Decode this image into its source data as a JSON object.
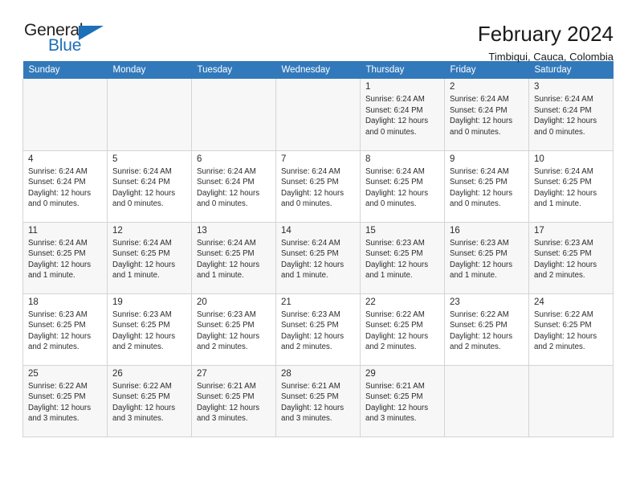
{
  "brand": {
    "name_part1": "General",
    "name_part2": "Blue",
    "triangle_icon": "triangle-icon",
    "color_primary": "#1d6fb8",
    "color_text": "#231f20"
  },
  "header": {
    "title": "February 2024",
    "subtitle": "Timbiqui, Cauca, Colombia"
  },
  "calendar": {
    "header_bg": "#3279bb",
    "columns": [
      "Sunday",
      "Monday",
      "Tuesday",
      "Wednesday",
      "Thursday",
      "Friday",
      "Saturday"
    ],
    "weeks": [
      [
        {
          "day": ""
        },
        {
          "day": ""
        },
        {
          "day": ""
        },
        {
          "day": ""
        },
        {
          "day": "1",
          "sunrise": "Sunrise: 6:24 AM",
          "sunset": "Sunset: 6:24 PM",
          "daylight_line1": "Daylight: 12 hours",
          "daylight_line2": "and 0 minutes."
        },
        {
          "day": "2",
          "sunrise": "Sunrise: 6:24 AM",
          "sunset": "Sunset: 6:24 PM",
          "daylight_line1": "Daylight: 12 hours",
          "daylight_line2": "and 0 minutes."
        },
        {
          "day": "3",
          "sunrise": "Sunrise: 6:24 AM",
          "sunset": "Sunset: 6:24 PM",
          "daylight_line1": "Daylight: 12 hours",
          "daylight_line2": "and 0 minutes."
        }
      ],
      [
        {
          "day": "4",
          "sunrise": "Sunrise: 6:24 AM",
          "sunset": "Sunset: 6:24 PM",
          "daylight_line1": "Daylight: 12 hours",
          "daylight_line2": "and 0 minutes."
        },
        {
          "day": "5",
          "sunrise": "Sunrise: 6:24 AM",
          "sunset": "Sunset: 6:24 PM",
          "daylight_line1": "Daylight: 12 hours",
          "daylight_line2": "and 0 minutes."
        },
        {
          "day": "6",
          "sunrise": "Sunrise: 6:24 AM",
          "sunset": "Sunset: 6:24 PM",
          "daylight_line1": "Daylight: 12 hours",
          "daylight_line2": "and 0 minutes."
        },
        {
          "day": "7",
          "sunrise": "Sunrise: 6:24 AM",
          "sunset": "Sunset: 6:25 PM",
          "daylight_line1": "Daylight: 12 hours",
          "daylight_line2": "and 0 minutes."
        },
        {
          "day": "8",
          "sunrise": "Sunrise: 6:24 AM",
          "sunset": "Sunset: 6:25 PM",
          "daylight_line1": "Daylight: 12 hours",
          "daylight_line2": "and 0 minutes."
        },
        {
          "day": "9",
          "sunrise": "Sunrise: 6:24 AM",
          "sunset": "Sunset: 6:25 PM",
          "daylight_line1": "Daylight: 12 hours",
          "daylight_line2": "and 0 minutes."
        },
        {
          "day": "10",
          "sunrise": "Sunrise: 6:24 AM",
          "sunset": "Sunset: 6:25 PM",
          "daylight_line1": "Daylight: 12 hours",
          "daylight_line2": "and 1 minute."
        }
      ],
      [
        {
          "day": "11",
          "sunrise": "Sunrise: 6:24 AM",
          "sunset": "Sunset: 6:25 PM",
          "daylight_line1": "Daylight: 12 hours",
          "daylight_line2": "and 1 minute."
        },
        {
          "day": "12",
          "sunrise": "Sunrise: 6:24 AM",
          "sunset": "Sunset: 6:25 PM",
          "daylight_line1": "Daylight: 12 hours",
          "daylight_line2": "and 1 minute."
        },
        {
          "day": "13",
          "sunrise": "Sunrise: 6:24 AM",
          "sunset": "Sunset: 6:25 PM",
          "daylight_line1": "Daylight: 12 hours",
          "daylight_line2": "and 1 minute."
        },
        {
          "day": "14",
          "sunrise": "Sunrise: 6:24 AM",
          "sunset": "Sunset: 6:25 PM",
          "daylight_line1": "Daylight: 12 hours",
          "daylight_line2": "and 1 minute."
        },
        {
          "day": "15",
          "sunrise": "Sunrise: 6:23 AM",
          "sunset": "Sunset: 6:25 PM",
          "daylight_line1": "Daylight: 12 hours",
          "daylight_line2": "and 1 minute."
        },
        {
          "day": "16",
          "sunrise": "Sunrise: 6:23 AM",
          "sunset": "Sunset: 6:25 PM",
          "daylight_line1": "Daylight: 12 hours",
          "daylight_line2": "and 1 minute."
        },
        {
          "day": "17",
          "sunrise": "Sunrise: 6:23 AM",
          "sunset": "Sunset: 6:25 PM",
          "daylight_line1": "Daylight: 12 hours",
          "daylight_line2": "and 2 minutes."
        }
      ],
      [
        {
          "day": "18",
          "sunrise": "Sunrise: 6:23 AM",
          "sunset": "Sunset: 6:25 PM",
          "daylight_line1": "Daylight: 12 hours",
          "daylight_line2": "and 2 minutes."
        },
        {
          "day": "19",
          "sunrise": "Sunrise: 6:23 AM",
          "sunset": "Sunset: 6:25 PM",
          "daylight_line1": "Daylight: 12 hours",
          "daylight_line2": "and 2 minutes."
        },
        {
          "day": "20",
          "sunrise": "Sunrise: 6:23 AM",
          "sunset": "Sunset: 6:25 PM",
          "daylight_line1": "Daylight: 12 hours",
          "daylight_line2": "and 2 minutes."
        },
        {
          "day": "21",
          "sunrise": "Sunrise: 6:23 AM",
          "sunset": "Sunset: 6:25 PM",
          "daylight_line1": "Daylight: 12 hours",
          "daylight_line2": "and 2 minutes."
        },
        {
          "day": "22",
          "sunrise": "Sunrise: 6:22 AM",
          "sunset": "Sunset: 6:25 PM",
          "daylight_line1": "Daylight: 12 hours",
          "daylight_line2": "and 2 minutes."
        },
        {
          "day": "23",
          "sunrise": "Sunrise: 6:22 AM",
          "sunset": "Sunset: 6:25 PM",
          "daylight_line1": "Daylight: 12 hours",
          "daylight_line2": "and 2 minutes."
        },
        {
          "day": "24",
          "sunrise": "Sunrise: 6:22 AM",
          "sunset": "Sunset: 6:25 PM",
          "daylight_line1": "Daylight: 12 hours",
          "daylight_line2": "and 2 minutes."
        }
      ],
      [
        {
          "day": "25",
          "sunrise": "Sunrise: 6:22 AM",
          "sunset": "Sunset: 6:25 PM",
          "daylight_line1": "Daylight: 12 hours",
          "daylight_line2": "and 3 minutes."
        },
        {
          "day": "26",
          "sunrise": "Sunrise: 6:22 AM",
          "sunset": "Sunset: 6:25 PM",
          "daylight_line1": "Daylight: 12 hours",
          "daylight_line2": "and 3 minutes."
        },
        {
          "day": "27",
          "sunrise": "Sunrise: 6:21 AM",
          "sunset": "Sunset: 6:25 PM",
          "daylight_line1": "Daylight: 12 hours",
          "daylight_line2": "and 3 minutes."
        },
        {
          "day": "28",
          "sunrise": "Sunrise: 6:21 AM",
          "sunset": "Sunset: 6:25 PM",
          "daylight_line1": "Daylight: 12 hours",
          "daylight_line2": "and 3 minutes."
        },
        {
          "day": "29",
          "sunrise": "Sunrise: 6:21 AM",
          "sunset": "Sunset: 6:25 PM",
          "daylight_line1": "Daylight: 12 hours",
          "daylight_line2": "and 3 minutes."
        },
        {
          "day": ""
        },
        {
          "day": ""
        }
      ]
    ]
  }
}
